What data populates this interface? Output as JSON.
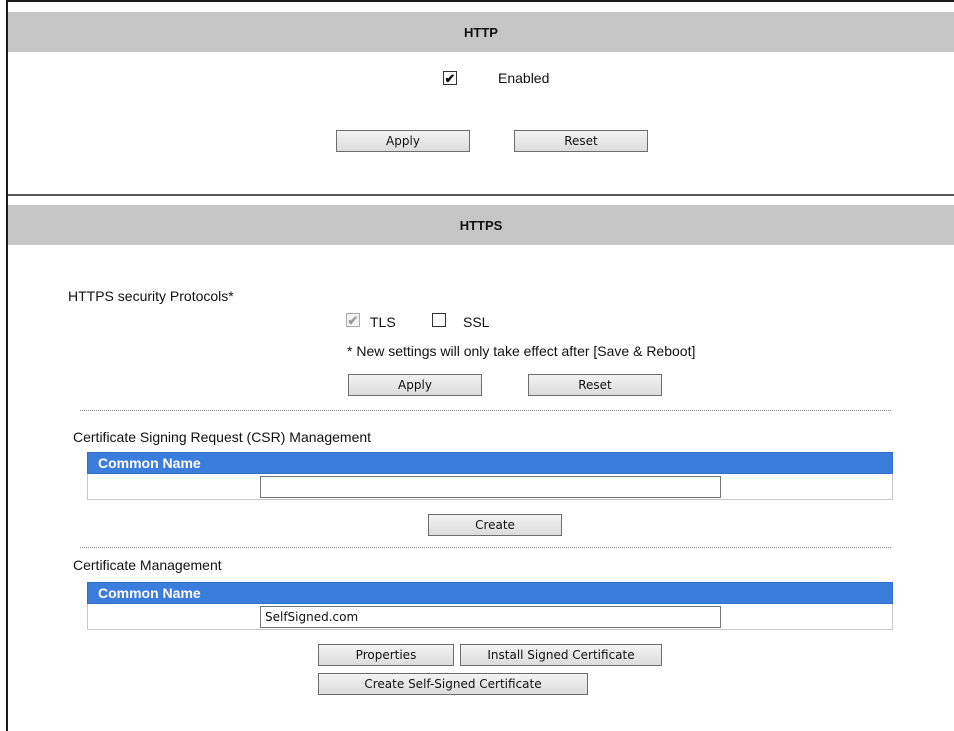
{
  "http": {
    "title": "HTTP",
    "enabled_checked": true,
    "enabled_label": "Enabled",
    "apply_label": "Apply",
    "reset_label": "Reset"
  },
  "https": {
    "title": "HTTPS",
    "protocols_label": "HTTPS security Protocols*",
    "tls_label": "TLS",
    "tls_checked": true,
    "ssl_label": "SSL",
    "ssl_checked": false,
    "note": "* New settings will only take effect after [Save & Reboot]",
    "apply_label": "Apply",
    "reset_label": "Reset"
  },
  "csr": {
    "title": "Certificate Signing Request (CSR) Management",
    "column_header": "Common Name",
    "input_value": "",
    "create_label": "Create"
  },
  "cert": {
    "title": "Certificate Management",
    "column_header": "Common Name",
    "input_value": "SelfSigned.com",
    "properties_label": "Properties",
    "install_label": "Install Signed Certificate",
    "self_signed_label": "Create Self-Signed Certificate"
  },
  "colors": {
    "header_bg": "#c6c6c6",
    "table_header_bg": "#3b7ddc"
  }
}
